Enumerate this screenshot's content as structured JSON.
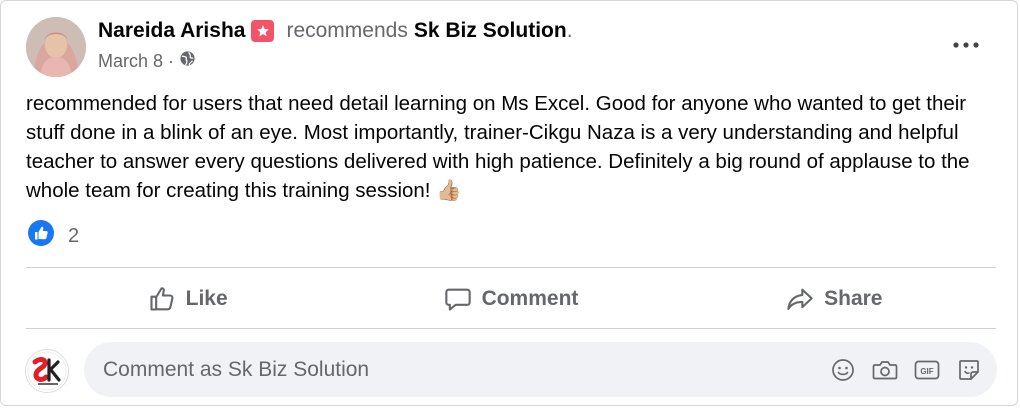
{
  "post": {
    "author_name": "Nareida Arisha",
    "verb": "recommends",
    "page_name": "Sk Biz Solution",
    "period": ".",
    "date": "March 8",
    "date_separator": "·",
    "privacy_icon": "globe-icon",
    "body": "recommended for users that need detail learning on Ms Excel. Good for anyone who wanted to get their stuff done in a blink of an eye. Most importantly, trainer-Cikgu Naza is a very understanding and helpful teacher to answer every questions delivered with high patience. Definitely a big round of applause to the whole team for creating this training session! 👍🏼"
  },
  "reactions": {
    "icon": "like-reaction-icon",
    "count": "2"
  },
  "actions": {
    "like_label": "Like",
    "comment_label": "Comment",
    "share_label": "Share"
  },
  "comment_box": {
    "placeholder": "Comment as Sk Biz Solution",
    "icons": [
      "emoji-icon",
      "camera-icon",
      "gif-icon",
      "sticker-icon"
    ]
  },
  "colors": {
    "like_blue": "#1877f2",
    "badge_pink": "#f35369",
    "muted_text": "#65676b",
    "comment_bg": "#f0f2f5"
  }
}
